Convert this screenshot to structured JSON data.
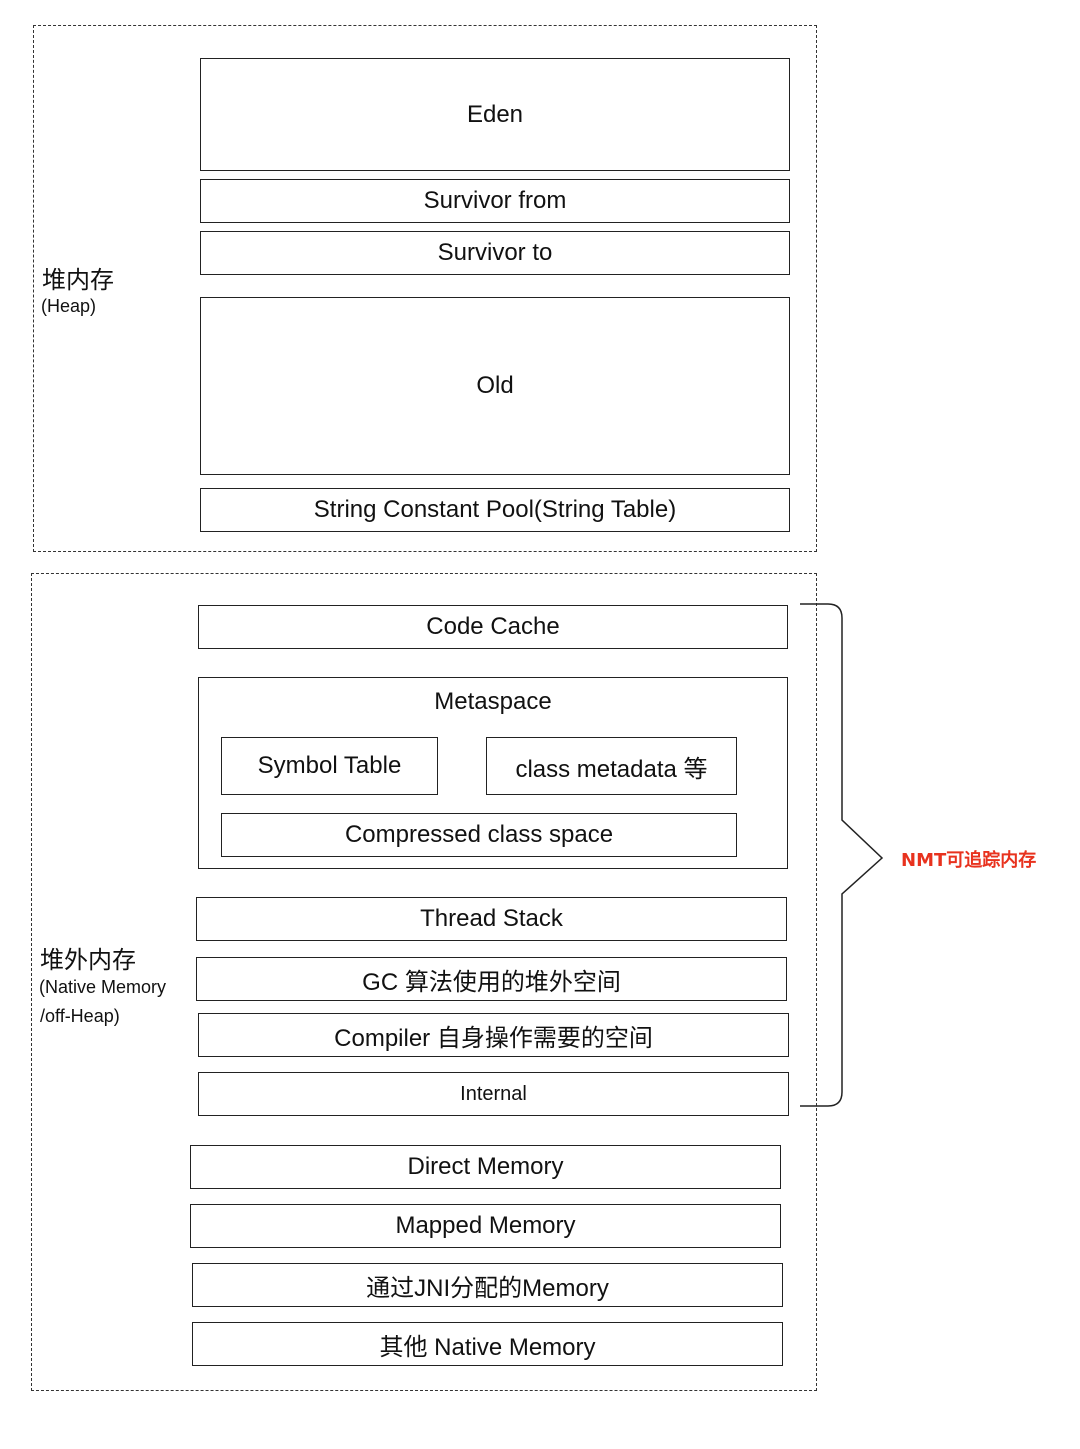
{
  "heap": {
    "title": "堆内存",
    "subtitle": "(Heap)",
    "regions": [
      "Eden",
      "Survivor from",
      "Survivor to",
      "Old",
      "String Constant Pool(String Table)"
    ]
  },
  "native": {
    "title": "堆外内存",
    "subtitle_line1": "(Native Memory",
    "subtitle_line2": "/off-Heap)",
    "code_cache": "Code Cache",
    "metaspace": {
      "title": "Metaspace",
      "symbol_table": "Symbol Table",
      "class_metadata": "class metadata 等",
      "compressed": "Compressed class space"
    },
    "thread_stack": "Thread Stack",
    "gc": "GC 算法使用的堆外空间",
    "compiler": "Compiler 自身操作需要的空间",
    "internal": "Internal",
    "direct": "Direct Memory",
    "mapped": "Mapped Memory",
    "jni": "通过JNI分配的Memory",
    "other": "其他 Native Memory"
  },
  "annotation": {
    "label": "NMT可追踪内存",
    "color": "#e8321e"
  }
}
